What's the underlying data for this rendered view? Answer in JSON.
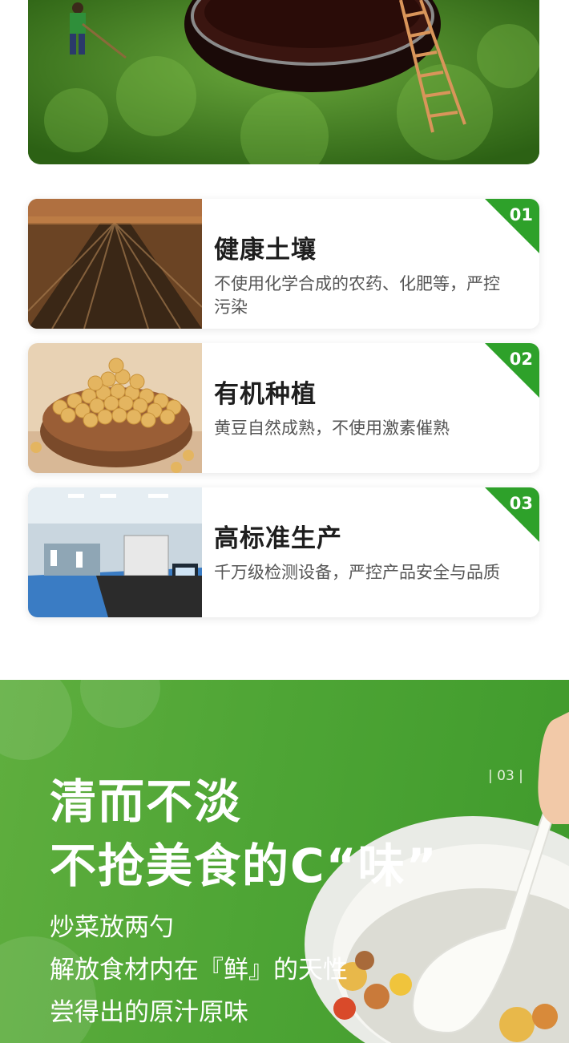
{
  "features": [
    {
      "number": "01",
      "title": "健康土壤",
      "desc": "不使用化学合成的农药、化肥等，严控污染",
      "photo": "farm-field-photo"
    },
    {
      "number": "02",
      "title": "有机种植",
      "desc": "黄豆自然成熟，不使用激素催熟",
      "photo": "soybean-bowl-photo"
    },
    {
      "number": "03",
      "title": "高标准生产",
      "desc": "千万级检测设备，严控产品安全与品质",
      "photo": "laboratory-photo"
    }
  ],
  "promo": {
    "page_number": "| 03 |",
    "headline_1": "清而不淡",
    "headline_2": "不抢美食的C“味”",
    "line_1": "炒菜放两勺",
    "line_2": "解放食材内在『鲜』的天性",
    "line_3": "尝得出的原汁原味"
  },
  "colors": {
    "accent_green": "#2ea12a",
    "promo_green": "#4ea535"
  }
}
